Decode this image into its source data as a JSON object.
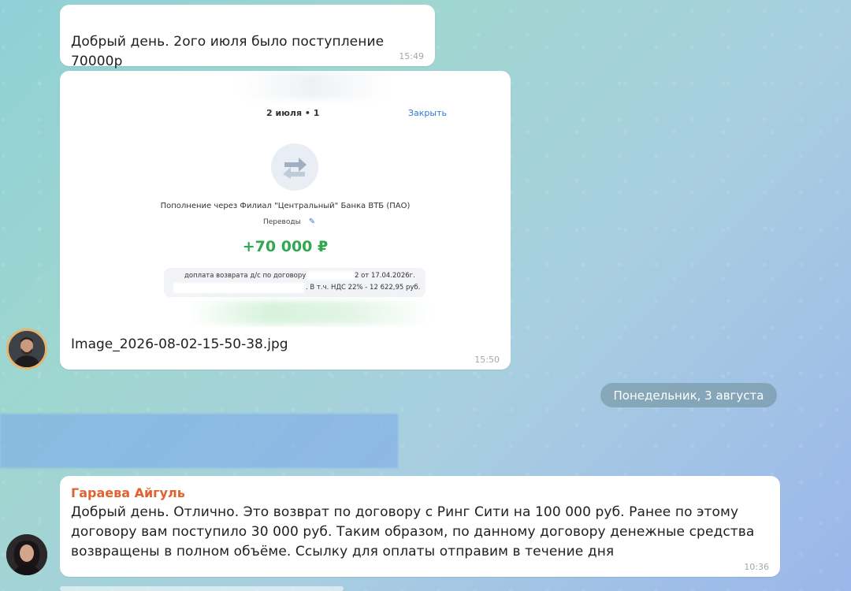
{
  "messages": [
    {
      "text": "Добрый день. 2ого июля было поступление 70000р",
      "time": "15:49"
    },
    {
      "image": {
        "date": "2 июля • 1",
        "close_label": "Закрыть",
        "icon": "transfer-arrows-icon",
        "description": "Пополнение через Филиал \"Центральный\" Банка ВТБ (ПАО)",
        "tag": "Переводы",
        "amount": "+70 000 ₽",
        "note_line1": "доплата возврата д/с по договору N",
        "note_line1_end": "2 от 17.04.2026г.",
        "note_line2": ". В т.ч. НДС 22% - 12 622,95 руб.",
        "amount_color": "#2fa84f"
      },
      "filename": "Image_2026-08-02-15-50-38.jpg",
      "time": "15:50"
    },
    {
      "sender": "Гараева Айгуль",
      "sender_color": "#e2622f",
      "text": "Добрый день. Отлично. Это возврат по договору с Ринг Сити на 100 000 руб. Ранее по этому договору вам поступило 30 000 руб. Таким образом, по данному договору денежные средства возвращены в полном объёме. Ссылку для оплаты отправим в течение дня",
      "time": "10:36"
    }
  ],
  "date_separator": "Понедельник, 3 августа"
}
